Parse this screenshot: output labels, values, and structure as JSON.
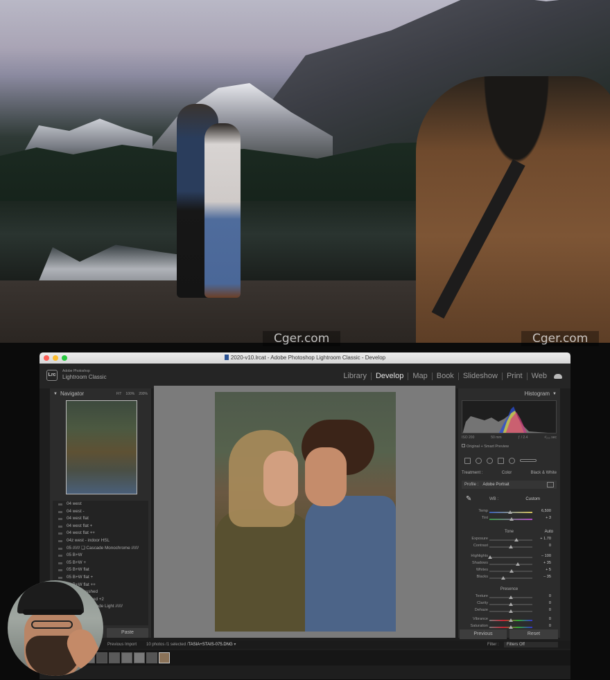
{
  "watermarks": [
    "Cger.com",
    "Cger.com"
  ],
  "window": {
    "title": "2020-v10.lrcat - Adobe Photoshop Lightroom Classic - Develop",
    "traffic_light_colors": [
      "#fc5f57",
      "#fdbc2e",
      "#28c840"
    ]
  },
  "app": {
    "badge": "Lrc",
    "brand_line1": "Adobe Photoshop",
    "brand_line2": "Lightroom Classic",
    "modules": [
      {
        "label": "Library"
      },
      {
        "label": "Develop",
        "active": true
      },
      {
        "label": "Map"
      },
      {
        "label": "Book"
      },
      {
        "label": "Slideshow"
      },
      {
        "label": "Print"
      },
      {
        "label": "Web"
      }
    ],
    "cloud_icon": "cloud-icon"
  },
  "navigator": {
    "title": "Navigator",
    "zoom_options": [
      "FIT",
      "100%",
      "200%"
    ]
  },
  "presets": [
    "04 west",
    "04 west -",
    "04 west flat",
    "04 west flat +",
    "04 west flat ++",
    "04z west - indoor HSL",
    "05 ////// ❏ Cascade Monochrome //////",
    "05 B+W",
    "05 B+W +",
    "05 B+W flat",
    "05 B+W flat +",
    "05 B+W flat ++",
    "05 B+W pushed",
    "05 B+W pushed +2",
    "06 ////// ❏ Cascade Light //////"
  ],
  "left_buttons": {
    "paste": "Paste"
  },
  "histogram": {
    "title": "Histogram",
    "iso": "ISO 200",
    "focal": "50 mm",
    "aperture": "ƒ / 2.4",
    "shutter": "¹⁄₂₀₀ sec",
    "preview": "Original + Smart Preview"
  },
  "treatment": {
    "label": "Treatment :",
    "color": "Color",
    "bw": "Black & White"
  },
  "profile": {
    "label": "Profile :",
    "value": "Adobe Portrait"
  },
  "wb": {
    "label": "WB :",
    "value": "Custom"
  },
  "tone": {
    "title": "Tone",
    "auto": "Auto"
  },
  "presence": {
    "title": "Presence"
  },
  "sliders": [
    {
      "label": "Temp",
      "value": "6,500",
      "pos": 0.48,
      "group": "wb"
    },
    {
      "label": "Tint",
      "value": "+ 3",
      "pos": 0.51,
      "group": "wb"
    },
    {
      "label": "Exposure",
      "value": "+ 1.70",
      "pos": 0.63,
      "group": "tone"
    },
    {
      "label": "Contrast",
      "value": "0",
      "pos": 0.5,
      "group": "tone"
    },
    {
      "label": "Highlights",
      "value": "– 100",
      "pos": 0.02,
      "group": "tone"
    },
    {
      "label": "Shadows",
      "value": "+ 35",
      "pos": 0.66,
      "group": "tone"
    },
    {
      "label": "Whites",
      "value": "+ 5",
      "pos": 0.52,
      "group": "tone"
    },
    {
      "label": "Blacks",
      "value": "– 35",
      "pos": 0.33,
      "group": "tone"
    },
    {
      "label": "Texture",
      "value": "0",
      "pos": 0.5,
      "group": "presence"
    },
    {
      "label": "Clarity",
      "value": "0",
      "pos": 0.5,
      "group": "presence"
    },
    {
      "label": "Dehaze",
      "value": "0",
      "pos": 0.5,
      "group": "presence"
    },
    {
      "label": "Vibrance",
      "value": "0",
      "pos": 0.5,
      "group": "presence"
    },
    {
      "label": "Saturation",
      "value": "0",
      "pos": 0.5,
      "group": "presence"
    }
  ],
  "right_buttons": {
    "previous": "Previous",
    "reset": "Reset"
  },
  "filmbar": {
    "source": "Previous Import",
    "count": "10 photos /1 selected /",
    "filename": "TASIA+STAIS-075.DNG",
    "filter_label": "Filter :",
    "filter_value": "Filters Off"
  }
}
